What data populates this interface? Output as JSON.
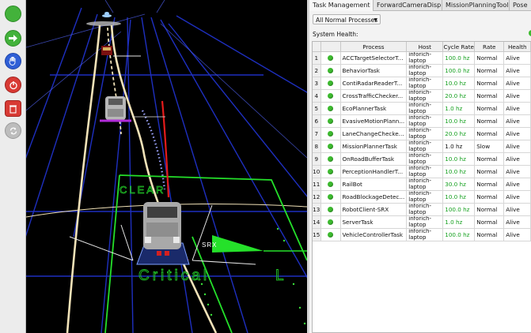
{
  "toolbar": {
    "buttons": [
      {
        "name": "play-icon",
        "color": "#43b23b"
      },
      {
        "name": "step-forward-icon",
        "color": "#43b23b"
      },
      {
        "name": "stop-hand-icon",
        "color": "#2f5fd6"
      },
      {
        "name": "emergency-stop-icon",
        "color": "#d83a34"
      },
      {
        "name": "trash-icon",
        "color": "#d83a34"
      },
      {
        "name": "reset-icon",
        "color": "#a8a8a8"
      }
    ]
  },
  "viewport": {
    "zone_label_clear": "CLEAR",
    "zone_label_critical": "Critical",
    "zone_label_l": "L",
    "srx_label": "SRX"
  },
  "tabs": [
    {
      "label": "Task Management",
      "active": true
    },
    {
      "label": "ForwardCameraDisplay",
      "active": false
    },
    {
      "label": "MissionPlanningTool",
      "active": false
    },
    {
      "label": "Pose",
      "active": false
    }
  ],
  "filter": {
    "value": "All Normal Processes"
  },
  "system_health": {
    "label": "System Health:",
    "status_color": "#3dbb2f"
  },
  "table": {
    "columns": [
      "",
      "",
      "Process",
      "Host",
      "Cycle Rate",
      "Rate",
      "Health"
    ],
    "rows": [
      {
        "num": "1",
        "process": "ACCTargetSelectorT...",
        "host": "inforich-laptop",
        "cycle": "100.0 hz",
        "rate": "Normal",
        "health": "Alive",
        "cycle_ok": true
      },
      {
        "num": "2",
        "process": "BehaviorTask",
        "host": "inforich-laptop",
        "cycle": "100.0 hz",
        "rate": "Normal",
        "health": "Alive",
        "cycle_ok": true
      },
      {
        "num": "3",
        "process": "ContiRadarReaderT...",
        "host": "inforich-laptop",
        "cycle": "10.0 hz",
        "rate": "Normal",
        "health": "Alive",
        "cycle_ok": true
      },
      {
        "num": "4",
        "process": "CrossTrafficChecker...",
        "host": "inforich-laptop",
        "cycle": "20.0 hz",
        "rate": "Normal",
        "health": "Alive",
        "cycle_ok": true
      },
      {
        "num": "5",
        "process": "EcoPlannerTask",
        "host": "inforich-laptop",
        "cycle": "1.0 hz",
        "rate": "Normal",
        "health": "Alive",
        "cycle_ok": true
      },
      {
        "num": "6",
        "process": "EvasiveMotionPlann...",
        "host": "inforich-laptop",
        "cycle": "10.0 hz",
        "rate": "Normal",
        "health": "Alive",
        "cycle_ok": true
      },
      {
        "num": "7",
        "process": "LaneChangeChecke...",
        "host": "inforich-laptop",
        "cycle": "20.0 hz",
        "rate": "Normal",
        "health": "Alive",
        "cycle_ok": true
      },
      {
        "num": "8",
        "process": "MissionPlannerTask",
        "host": "inforich-laptop",
        "cycle": "1.0 hz",
        "rate": "Slow",
        "health": "Alive",
        "cycle_ok": false
      },
      {
        "num": "9",
        "process": "OnRoadBufferTask",
        "host": "inforich-laptop",
        "cycle": "10.0 hz",
        "rate": "Normal",
        "health": "Alive",
        "cycle_ok": true
      },
      {
        "num": "10",
        "process": "PerceptionHandlerT...",
        "host": "inforich-laptop",
        "cycle": "10.0 hz",
        "rate": "Normal",
        "health": "Alive",
        "cycle_ok": true
      },
      {
        "num": "11",
        "process": "RailBot",
        "host": "inforich-laptop",
        "cycle": "30.0 hz",
        "rate": "Normal",
        "health": "Alive",
        "cycle_ok": true
      },
      {
        "num": "12",
        "process": "RoadBlockageDetec...",
        "host": "inforich-laptop",
        "cycle": "10.0 hz",
        "rate": "Normal",
        "health": "Alive",
        "cycle_ok": true
      },
      {
        "num": "13",
        "process": "RobotClient-SRX",
        "host": "inforich-laptop",
        "cycle": "100.0 hz",
        "rate": "Normal",
        "health": "Alive",
        "cycle_ok": true
      },
      {
        "num": "14",
        "process": "ServerTask",
        "host": "inforich-laptop",
        "cycle": "1.0 hz",
        "rate": "Normal",
        "health": "Alive",
        "cycle_ok": true
      },
      {
        "num": "15",
        "process": "VehicleControllerTask",
        "host": "inforich-laptop",
        "cycle": "100.0 hz",
        "rate": "Normal",
        "health": "Alive",
        "cycle_ok": true
      }
    ]
  }
}
